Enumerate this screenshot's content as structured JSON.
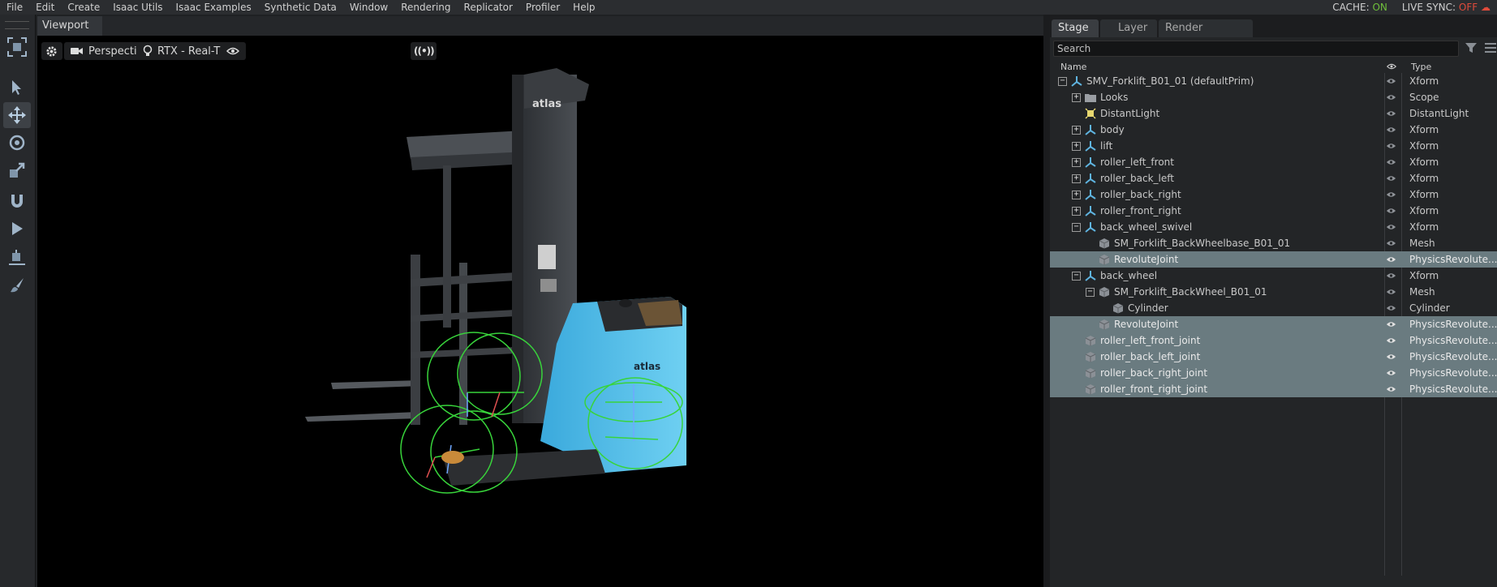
{
  "menu": [
    "File",
    "Edit",
    "Create",
    "Isaac Utils",
    "Isaac Examples",
    "Synthetic Data",
    "Window",
    "Rendering",
    "Replicator",
    "Profiler",
    "Help"
  ],
  "status": {
    "cache_label": "CACHE:",
    "cache_value": "ON",
    "live_sync_label": "LIVE SYNC:",
    "live_sync_value": "OFF"
  },
  "viewport": {
    "tab_label": "Viewport",
    "camera_label": "Perspective",
    "renderer_label": "RTX - Real-Time",
    "forklift_brand": "atlas"
  },
  "stage": {
    "tabs": [
      "Stage",
      "Layer",
      "Render Settings"
    ],
    "search_placeholder": "Search",
    "col_name": "Name",
    "col_type": "Type",
    "rows": [
      {
        "name": "SMV_Forklift_B01_01 (defaultPrim)",
        "type": "Xform",
        "depth": 0,
        "expander": "minus",
        "icon": "xform-icon",
        "selected": false
      },
      {
        "name": "Looks",
        "type": "Scope",
        "depth": 1,
        "expander": "plus",
        "icon": "folder-icon",
        "selected": false
      },
      {
        "name": "DistantLight",
        "type": "DistantLight",
        "depth": 1,
        "expander": "",
        "icon": "light-icon",
        "selected": false
      },
      {
        "name": "body",
        "type": "Xform",
        "depth": 1,
        "expander": "plus",
        "icon": "xform-icon",
        "selected": false
      },
      {
        "name": "lift",
        "type": "Xform",
        "depth": 1,
        "expander": "plus",
        "icon": "xform-icon",
        "selected": false
      },
      {
        "name": "roller_left_front",
        "type": "Xform",
        "depth": 1,
        "expander": "plus",
        "icon": "xform-icon",
        "selected": false
      },
      {
        "name": "roller_back_left",
        "type": "Xform",
        "depth": 1,
        "expander": "plus",
        "icon": "xform-icon",
        "selected": false
      },
      {
        "name": "roller_back_right",
        "type": "Xform",
        "depth": 1,
        "expander": "plus",
        "icon": "xform-icon",
        "selected": false
      },
      {
        "name": "roller_front_right",
        "type": "Xform",
        "depth": 1,
        "expander": "plus",
        "icon": "xform-icon",
        "selected": false
      },
      {
        "name": "back_wheel_swivel",
        "type": "Xform",
        "depth": 1,
        "expander": "minus",
        "icon": "xform-icon",
        "selected": false
      },
      {
        "name": "SM_Forklift_BackWheelbase_B01_01",
        "type": "Mesh",
        "depth": 2,
        "expander": "",
        "icon": "mesh-icon",
        "selected": false
      },
      {
        "name": "RevoluteJoint",
        "type": "PhysicsRevolute...",
        "depth": 2,
        "expander": "",
        "icon": "mesh-icon",
        "selected": true
      },
      {
        "name": "back_wheel",
        "type": "Xform",
        "depth": 1,
        "expander": "minus",
        "icon": "xform-icon",
        "selected": false
      },
      {
        "name": "SM_Forklift_BackWheel_B01_01",
        "type": "Mesh",
        "depth": 2,
        "expander": "minus",
        "icon": "mesh-icon",
        "selected": false
      },
      {
        "name": "Cylinder",
        "type": "Cylinder",
        "depth": 3,
        "expander": "",
        "icon": "mesh-icon",
        "selected": false
      },
      {
        "name": "RevoluteJoint",
        "type": "PhysicsRevolute...",
        "depth": 2,
        "expander": "",
        "icon": "mesh-icon",
        "selected": true
      },
      {
        "name": "roller_left_front_joint",
        "type": "PhysicsRevolute...",
        "depth": 1,
        "expander": "",
        "icon": "mesh-icon",
        "selected": true
      },
      {
        "name": "roller_back_left_joint",
        "type": "PhysicsRevolute...",
        "depth": 1,
        "expander": "",
        "icon": "mesh-icon",
        "selected": true
      },
      {
        "name": "roller_back_right_joint",
        "type": "PhysicsRevolute...",
        "depth": 1,
        "expander": "",
        "icon": "mesh-icon",
        "selected": true
      },
      {
        "name": "roller_front_right_joint",
        "type": "PhysicsRevolute...",
        "depth": 1,
        "expander": "",
        "icon": "mesh-icon",
        "selected": true
      }
    ]
  }
}
